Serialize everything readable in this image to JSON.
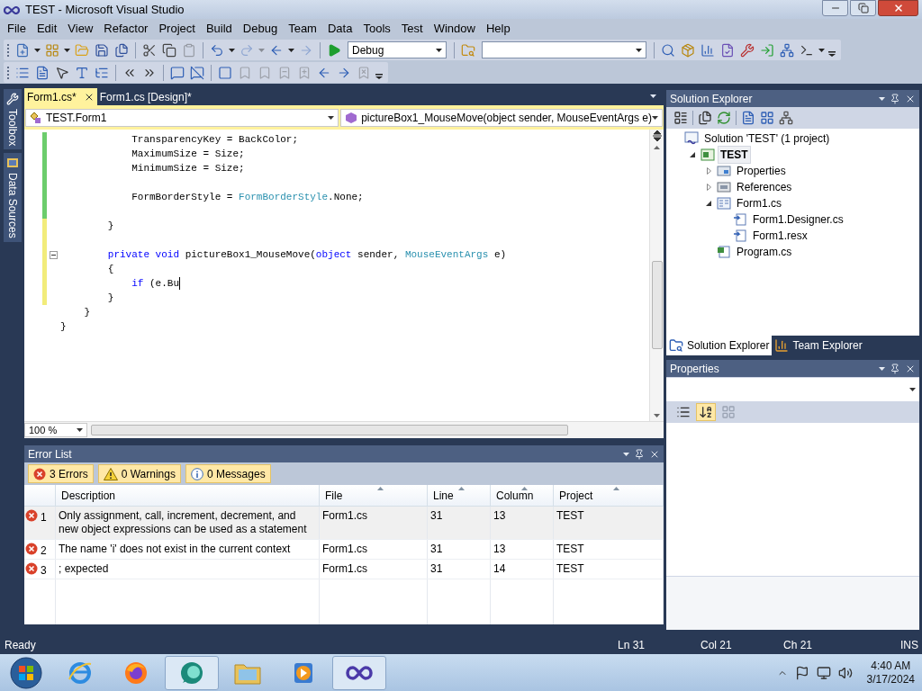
{
  "window": {
    "title": "TEST - Microsoft Visual Studio"
  },
  "menu": [
    "File",
    "Edit",
    "View",
    "Refactor",
    "Project",
    "Build",
    "Debug",
    "Team",
    "Data",
    "Tools",
    "Test",
    "Window",
    "Help"
  ],
  "toolbars": [
    [
      {
        "kind": "new-project",
        "disabled": false
      },
      {
        "kind": "caret",
        "disabled": false
      },
      {
        "kind": "add-item",
        "disabled": false
      },
      {
        "kind": "caret",
        "disabled": false
      },
      {
        "kind": "open",
        "disabled": false
      },
      {
        "kind": "save",
        "disabled": false
      },
      {
        "kind": "save-all",
        "disabled": false
      },
      {
        "kind": "separator"
      },
      {
        "kind": "cut",
        "disabled": false
      },
      {
        "kind": "copy",
        "disabled": false
      },
      {
        "kind": "paste",
        "disabled": true
      },
      {
        "kind": "separator"
      },
      {
        "kind": "undo",
        "disabled": false
      },
      {
        "kind": "caret",
        "disabled": false
      },
      {
        "kind": "redo",
        "disabled": true
      },
      {
        "kind": "caret",
        "disabled": true
      },
      {
        "kind": "back",
        "disabled": false
      },
      {
        "kind": "caret",
        "disabled": false
      },
      {
        "kind": "forward",
        "disabled": true
      },
      {
        "kind": "separator"
      },
      {
        "kind": "start",
        "disabled": false
      },
      {
        "kind": "combo",
        "value": "Debug",
        "disabled": false
      },
      {
        "kind": "separator"
      },
      {
        "kind": "find-in-files",
        "disabled": false
      },
      {
        "kind": "combo",
        "disabled": false
      },
      {
        "kind": "separator"
      },
      {
        "kind": "find",
        "disabled": false
      },
      {
        "kind": "object-browser",
        "disabled": false
      },
      {
        "kind": "chart",
        "disabled": false
      },
      {
        "kind": "checklist",
        "disabled": false
      },
      {
        "kind": "wrench",
        "disabled": false
      },
      {
        "kind": "import",
        "disabled": false
      },
      {
        "kind": "network",
        "disabled": false
      },
      {
        "kind": "terminal",
        "disabled": false
      },
      {
        "kind": "caret",
        "disabled": false
      },
      {
        "kind": "overflow",
        "disabled": false
      }
    ],
    [
      {
        "kind": "list-members",
        "disabled": false
      },
      {
        "kind": "parameter-info",
        "disabled": false
      },
      {
        "kind": "quick-info",
        "disabled": false
      },
      {
        "kind": "word-complete",
        "disabled": false
      },
      {
        "kind": "outline",
        "disabled": false
      },
      {
        "kind": "separator"
      },
      {
        "kind": "outdent",
        "disabled": false
      },
      {
        "kind": "indent",
        "disabled": false
      },
      {
        "kind": "separator"
      },
      {
        "kind": "comment",
        "disabled": false
      },
      {
        "kind": "uncomment",
        "disabled": false
      },
      {
        "kind": "separator"
      },
      {
        "kind": "bookmark",
        "disabled": false
      },
      {
        "kind": "prev-bookmark",
        "disabled": true
      },
      {
        "kind": "next-bookmark",
        "disabled": true
      },
      {
        "kind": "prev-folder",
        "disabled": true
      },
      {
        "kind": "next-folder",
        "disabled": true
      },
      {
        "kind": "prev-doc",
        "disabled": false
      },
      {
        "kind": "next-doc",
        "disabled": false
      },
      {
        "kind": "clear",
        "disabled": true
      },
      {
        "kind": "overflow",
        "disabled": false
      }
    ]
  ],
  "side_tabs": [
    {
      "kind": "toolbox",
      "label": "Toolbox"
    },
    {
      "kind": "data",
      "label": "Data Sources"
    }
  ],
  "editor": {
    "tabs": [
      {
        "label": "Form1.cs*",
        "selected": true
      },
      {
        "label": "Form1.cs [Design]*",
        "selected": false
      }
    ],
    "class_dropdown": "TEST.Form1",
    "member_dropdown": "pictureBox1_MouseMove(object sender, MouseEventArgs e)",
    "lines": [
      {
        "color": "#6ccd6c",
        "fold": false,
        "cursor": false,
        "segments": [
          {
            "kind": "plain",
            "text": "            TransparencyKey = BackColor;"
          }
        ]
      },
      {
        "color": "#6ccd6c",
        "fold": false,
        "cursor": false,
        "segments": [
          {
            "kind": "plain",
            "text": "            MaximumSize = Size;"
          }
        ]
      },
      {
        "color": "#6ccd6c",
        "fold": false,
        "cursor": false,
        "segments": [
          {
            "kind": "plain",
            "text": "            MinimumSize = Size;"
          }
        ]
      },
      {
        "color": "#6ccd6c",
        "fold": false,
        "cursor": false
      },
      {
        "color": "#6ccd6c",
        "fold": false,
        "cursor": false,
        "segments": [
          {
            "kind": "plain",
            "text": "            FormBorderStyle = "
          },
          {
            "kind": "type",
            "text": "FormBorderStyle"
          },
          {
            "kind": "plain",
            "text": ".None;"
          }
        ]
      },
      {
        "color": "#6ccd6c",
        "fold": false,
        "cursor": false
      },
      {
        "color": "#f2ec7a",
        "fold": false,
        "cursor": false,
        "segments": [
          {
            "kind": "plain",
            "text": "        }"
          }
        ]
      },
      {
        "color": "#f2ec7a",
        "fold": false,
        "cursor": false
      },
      {
        "color": "#f2ec7a",
        "fold": true,
        "cursor": false,
        "segments": [
          {
            "kind": "keyword",
            "text": "        private void"
          },
          {
            "kind": "plain",
            "text": " pictureBox1_MouseMove("
          },
          {
            "kind": "keyword",
            "text": "object"
          },
          {
            "kind": "plain",
            "text": " sender, "
          },
          {
            "kind": "type",
            "text": "MouseEventArgs"
          },
          {
            "kind": "plain",
            "text": " e)"
          }
        ]
      },
      {
        "color": "#f2ec7a",
        "fold": false,
        "cursor": false,
        "segments": [
          {
            "kind": "plain",
            "text": "        {"
          }
        ]
      },
      {
        "color": "#f2ec7a",
        "fold": false,
        "cursor": true,
        "segments": [
          {
            "kind": "keyword",
            "text": "            if"
          },
          {
            "kind": "plain",
            "text": " (e.Bu"
          }
        ]
      },
      {
        "color": "#f2ec7a",
        "fold": false,
        "cursor": false,
        "segments": [
          {
            "kind": "plain",
            "text": "        }"
          }
        ]
      },
      {
        "fold": false,
        "cursor": false,
        "segments": [
          {
            "kind": "plain",
            "text": "    }"
          }
        ]
      },
      {
        "fold": false,
        "cursor": false,
        "segments": [
          {
            "kind": "plain",
            "text": "}"
          }
        ]
      }
    ],
    "zoom": "100 %"
  },
  "error_list": {
    "title": "Error List",
    "filters": [
      {
        "kind": "error",
        "label": "3 Errors",
        "selected": true
      },
      {
        "kind": "warning",
        "label": "0 Warnings",
        "selected": true
      },
      {
        "kind": "message",
        "label": "0 Messages",
        "selected": true
      }
    ],
    "columns": [
      "Description",
      "File",
      "Line",
      "Column",
      "Project"
    ],
    "rows": [
      {
        "number": "1",
        "description": "Only assignment, call, increment, decrement, and new object expressions can be used as a statement",
        "file": "Form1.cs",
        "line": "31",
        "column": "13",
        "project": "TEST",
        "selected": true
      },
      {
        "number": "2",
        "description": "The name 'i' does not exist in the current context",
        "file": "Form1.cs",
        "line": "31",
        "column": "13",
        "project": "TEST",
        "selected": false
      },
      {
        "number": "3",
        "description": "; expected",
        "file": "Form1.cs",
        "line": "31",
        "column": "14",
        "project": "TEST",
        "selected": false
      }
    ]
  },
  "solution_explorer": {
    "title": "Solution Explorer",
    "tree": [
      {
        "label": "Solution 'TEST' (1 project)",
        "kind": "solution",
        "selected": false,
        "children": [
          {
            "label": "TEST",
            "kind": "project",
            "selected": true,
            "expanded": true,
            "children": [
              {
                "label": "Properties",
                "kind": "properties",
                "selected": false,
                "expanded": false
              },
              {
                "label": "References",
                "kind": "references",
                "selected": false,
                "expanded": false
              },
              {
                "label": "Form1.cs",
                "kind": "form",
                "selected": false,
                "expanded": true,
                "children": [
                  {
                    "label": "Form1.Designer.cs",
                    "kind": "dependent",
                    "selected": false
                  },
                  {
                    "label": "Form1.resx",
                    "kind": "dependent",
                    "selected": false
                  }
                ]
              },
              {
                "label": "Program.cs",
                "kind": "csfile",
                "selected": false
              }
            ]
          }
        ]
      }
    ],
    "tabs": [
      {
        "label": "Solution Explorer",
        "selected": true
      },
      {
        "label": "Team Explorer",
        "selected": false
      }
    ]
  },
  "properties": {
    "title": "Properties",
    "view_buttons": [
      {
        "kind": "categorized",
        "selected": false
      },
      {
        "kind": "alphabetical",
        "selected": true
      },
      {
        "kind": "pages",
        "selected": false
      }
    ]
  },
  "status_bar": {
    "message": "Ready",
    "line": "Ln 31",
    "column": "Col 21",
    "char": "Ch 21",
    "mode": "INS"
  },
  "taskbar": {
    "apps": [
      {
        "kind": "browser",
        "selected": false
      },
      {
        "kind": "firefox",
        "selected": false
      },
      {
        "kind": "chat",
        "selected": true
      },
      {
        "kind": "folder",
        "selected": false
      },
      {
        "kind": "media",
        "selected": false
      },
      {
        "kind": "studio",
        "selected": true
      }
    ],
    "time": "4:40 AM",
    "date": "3/17/2024"
  }
}
